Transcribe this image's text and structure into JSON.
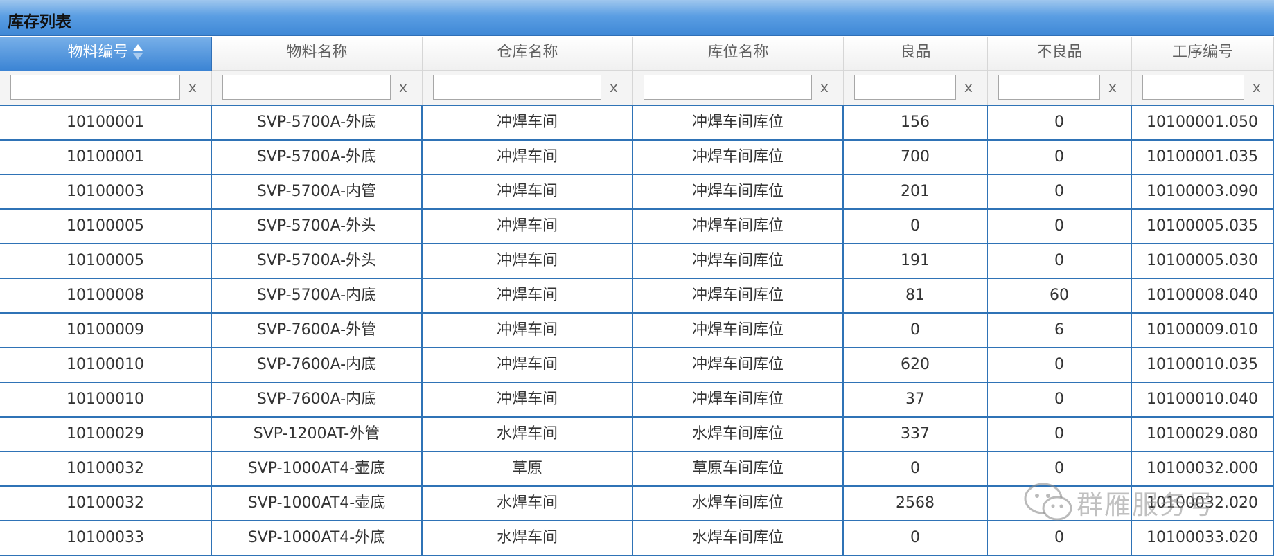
{
  "panel": {
    "title": "库存列表"
  },
  "columns": [
    {
      "label": "物料编号",
      "sorted": true
    },
    {
      "label": "物料名称"
    },
    {
      "label": "仓库名称"
    },
    {
      "label": "库位名称"
    },
    {
      "label": "良品"
    },
    {
      "label": "不良品"
    },
    {
      "label": "工序编号"
    }
  ],
  "filters": {
    "clear_label": "x",
    "values": [
      "",
      "",
      "",
      "",
      "",
      "",
      ""
    ]
  },
  "rows": [
    [
      "10100001",
      "SVP-5700A-外底",
      "冲焊车间",
      "冲焊车间库位",
      "156",
      "0",
      "10100001.050"
    ],
    [
      "10100001",
      "SVP-5700A-外底",
      "冲焊车间",
      "冲焊车间库位",
      "700",
      "0",
      "10100001.035"
    ],
    [
      "10100003",
      "SVP-5700A-内管",
      "冲焊车间",
      "冲焊车间库位",
      "201",
      "0",
      "10100003.090"
    ],
    [
      "10100005",
      "SVP-5700A-外头",
      "冲焊车间",
      "冲焊车间库位",
      "0",
      "0",
      "10100005.035"
    ],
    [
      "10100005",
      "SVP-5700A-外头",
      "冲焊车间",
      "冲焊车间库位",
      "191",
      "0",
      "10100005.030"
    ],
    [
      "10100008",
      "SVP-5700A-内底",
      "冲焊车间",
      "冲焊车间库位",
      "81",
      "60",
      "10100008.040"
    ],
    [
      "10100009",
      "SVP-7600A-外管",
      "冲焊车间",
      "冲焊车间库位",
      "0",
      "6",
      "10100009.010"
    ],
    [
      "10100010",
      "SVP-7600A-内底",
      "冲焊车间",
      "冲焊车间库位",
      "620",
      "0",
      "10100010.035"
    ],
    [
      "10100010",
      "SVP-7600A-内底",
      "冲焊车间",
      "冲焊车间库位",
      "37",
      "0",
      "10100010.040"
    ],
    [
      "10100029",
      "SVP-1200AT-外管",
      "水焊车间",
      "水焊车间库位",
      "337",
      "0",
      "10100029.080"
    ],
    [
      "10100032",
      "SVP-1000AT4-壶底",
      "草原",
      "草原车间库位",
      "0",
      "0",
      "10100032.000"
    ],
    [
      "10100032",
      "SVP-1000AT4-壶底",
      "水焊车间",
      "水焊车间库位",
      "2568",
      "",
      "10100032.020"
    ],
    [
      "10100033",
      "SVP-1000AT4-外底",
      "水焊车间",
      "水焊车间库位",
      "0",
      "0",
      "10100033.020"
    ]
  ],
  "watermark": {
    "text": "群雁服务号",
    "icon": "wechat-icon"
  },
  "colors": {
    "accent": "#3f88d6",
    "grid_line": "#2f73b6"
  }
}
